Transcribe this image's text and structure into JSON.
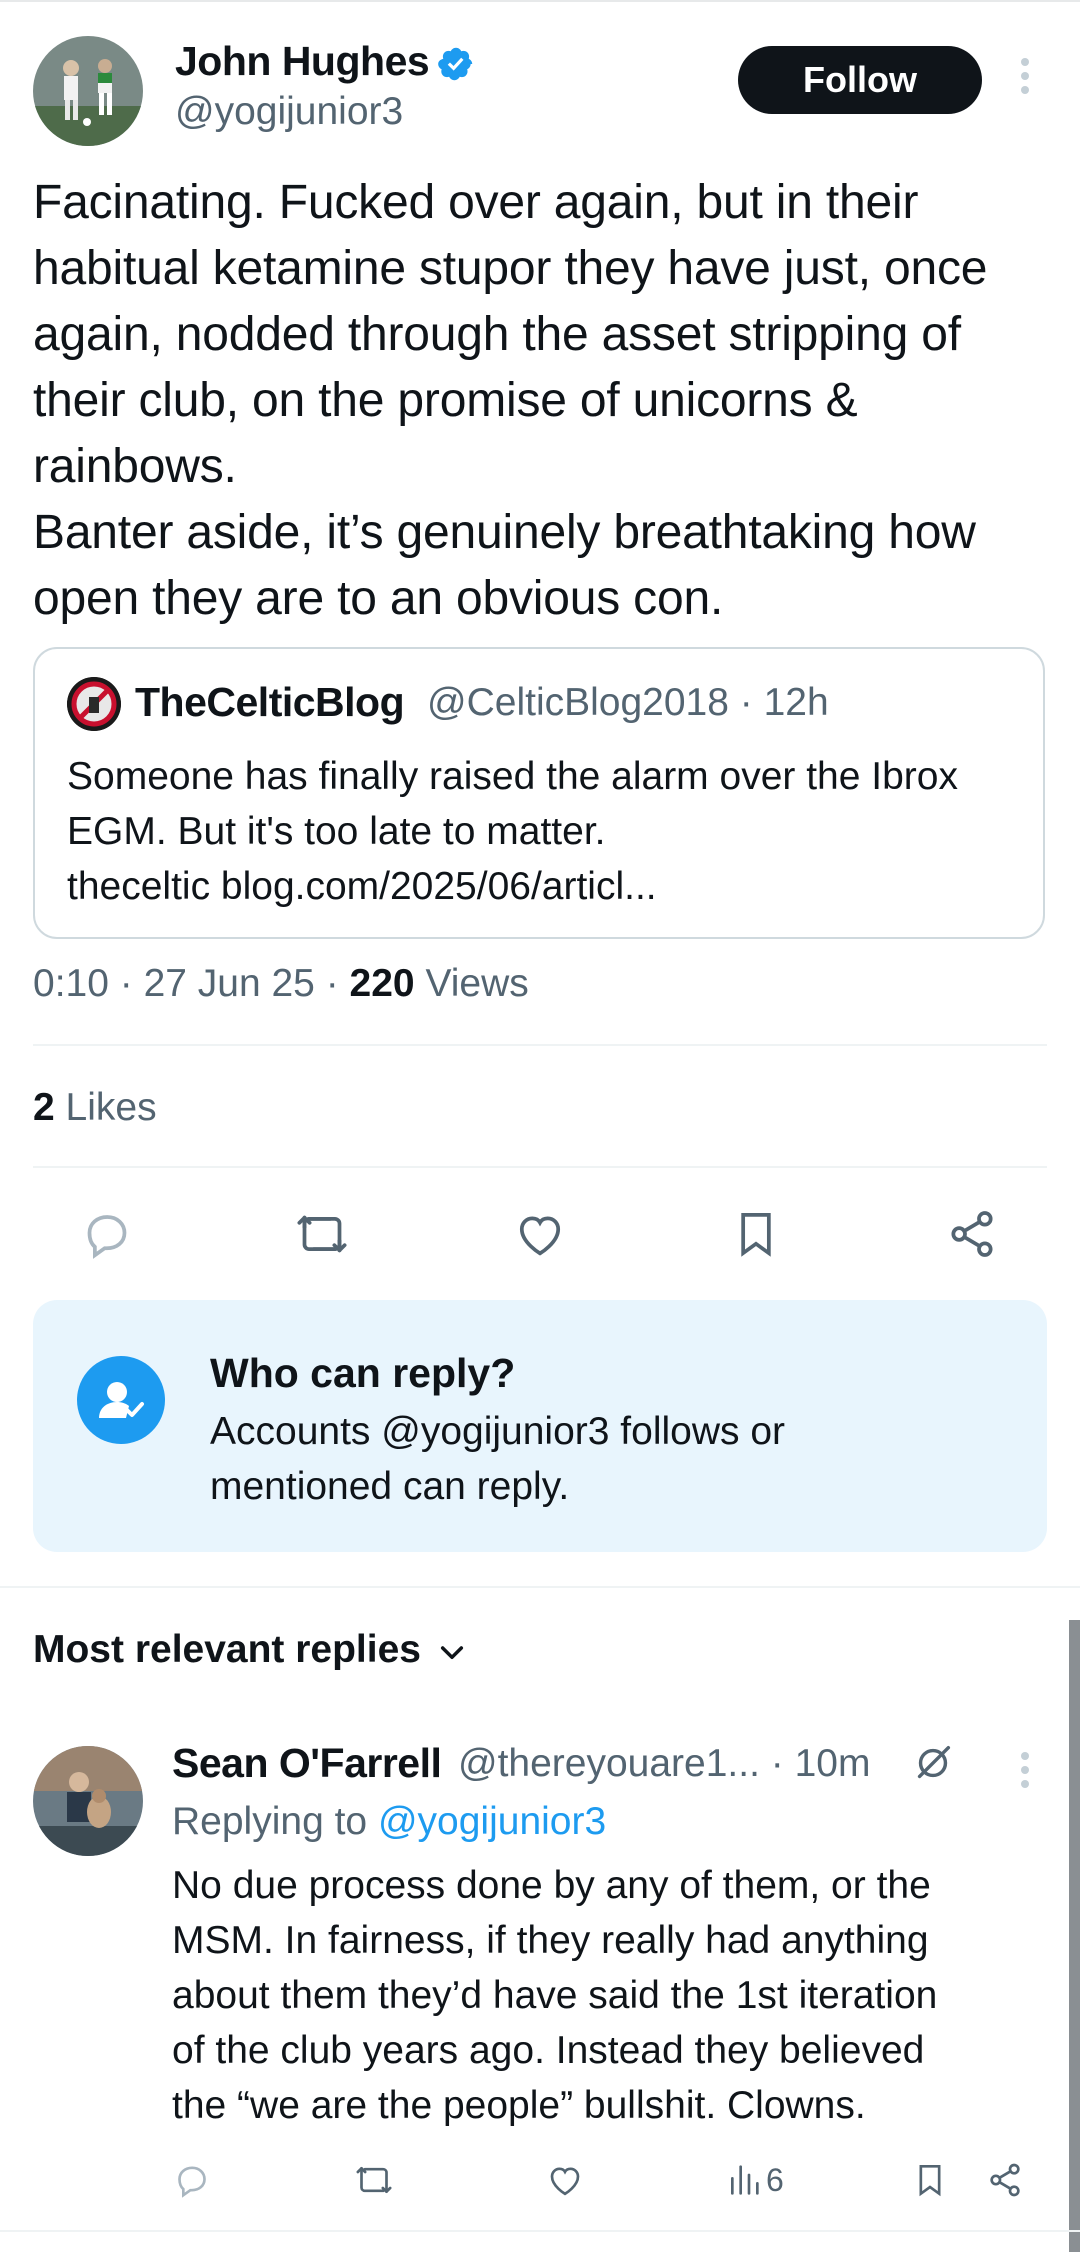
{
  "tweet": {
    "author": {
      "name": "John Hughes",
      "handle": "@yogijunior3",
      "verified": true
    },
    "follow_label": "Follow",
    "text": "Facinating. Fucked over again, but in their habitual ketamine stupor they have just, once again, nodded through the asset stripping of their club, on the promise of unicorns & rainbows.\nBanter aside, it’s genuinely breathtaking how open they are to an obvious con.",
    "quote": {
      "name": "TheCelticBlog",
      "meta": "@CelticBlog2018 · 12h",
      "text": "Someone has finally raised the alarm over the Ibrox EGM. But it's too late to matter.\ntheceltic blog.com/2025/06/articl..."
    },
    "timestamp": "0:10 · 27 Jun 25 · ",
    "views_count": "220",
    "views_label": " Views",
    "likes_count": "2",
    "likes_label": " Likes"
  },
  "actions": [
    "reply-icon",
    "retweet-icon",
    "heart-icon",
    "bookmark-icon",
    "share-icon"
  ],
  "who_can_reply": {
    "title": "Who can reply?",
    "description": "Accounts @yogijunior3 follows or\nmentioned can reply."
  },
  "replies_sort": {
    "label": "Most relevant replies"
  },
  "reply": {
    "name": "Sean O'Farrell",
    "meta": "@thereyouare1... · 10m",
    "replying_prefix": "Replying to ",
    "replying_handle": "@yogijunior3",
    "text": "No due process done by any of them, or the\nMSM. In fairness, if they really had anything\nabout them they’d have said the 1st iteration\nof the club years ago. Instead they believed\nthe “we are the people” bullshit. Clowns.",
    "views": "6"
  },
  "colors": {
    "accent": "#1d9bf0",
    "text": "#0f1419",
    "muted": "#536471",
    "reply_box_bg": "#e8f5fd"
  }
}
